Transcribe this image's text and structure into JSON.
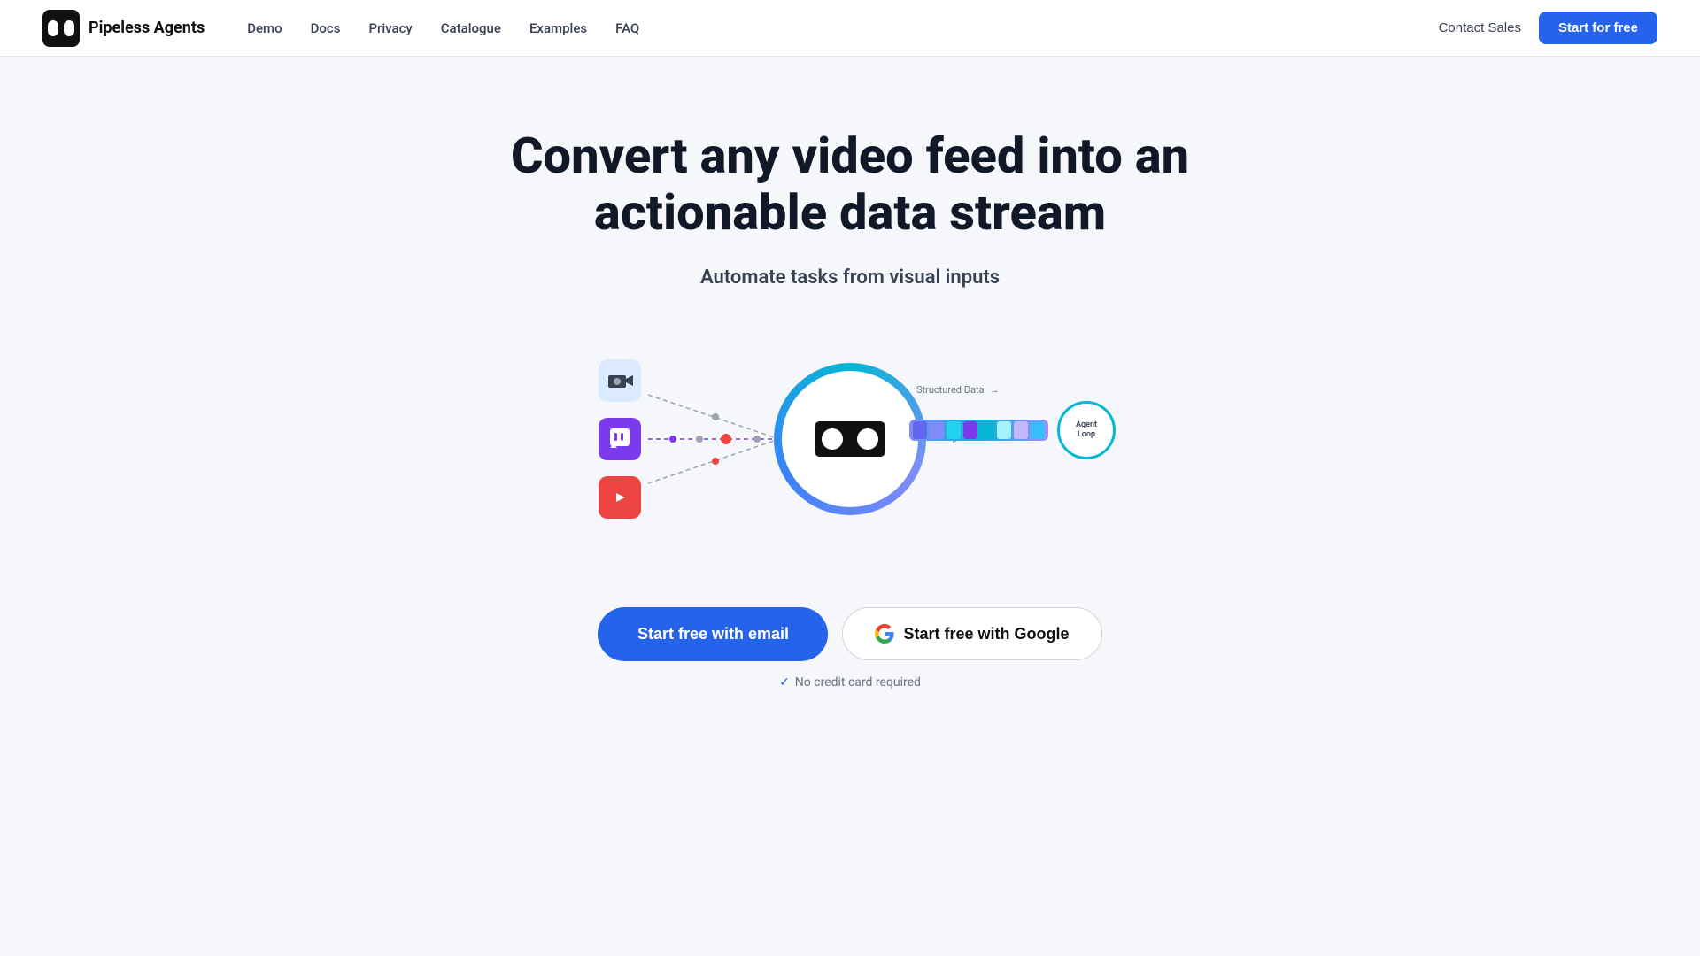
{
  "nav": {
    "brand": "Pipeless Agents",
    "links": [
      {
        "label": "Demo",
        "href": "#"
      },
      {
        "label": "Docs",
        "href": "#"
      },
      {
        "label": "Privacy",
        "href": "#"
      },
      {
        "label": "Catalogue",
        "href": "#"
      },
      {
        "label": "Examples",
        "href": "#"
      },
      {
        "label": "FAQ",
        "href": "#"
      }
    ],
    "contact_label": "Contact Sales",
    "start_label": "Start for free"
  },
  "hero": {
    "title": "Convert any video feed into an actionable data stream",
    "subtitle": "Automate tasks from visual inputs"
  },
  "diagram": {
    "structured_data_label": "Structured Data",
    "agent_label_line1": "Agent",
    "agent_label_line2": "Loop"
  },
  "cta": {
    "email_button": "Start free with email",
    "google_button": "Start free with Google",
    "no_credit": "No credit card required"
  }
}
